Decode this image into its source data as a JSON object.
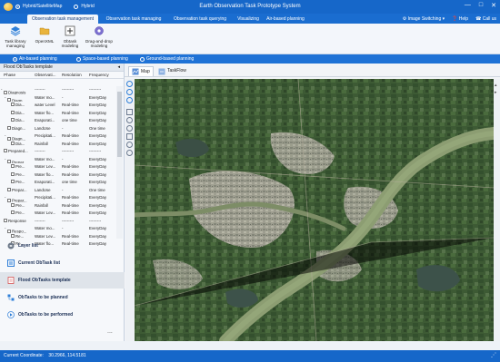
{
  "titlebar": {
    "map_options": [
      "Hybrid/SatelliteMap",
      "Hybrid"
    ],
    "title": "Earth Observation Task Prototype System",
    "win_buttons": [
      "—",
      "□",
      "✕"
    ]
  },
  "menubar": {
    "tabs": [
      "Observation task management",
      "Observation task managing",
      "Observation task querying",
      "Visualizing",
      "Air-based planning"
    ],
    "right": [
      "Image Switching",
      "Help",
      "Call us"
    ]
  },
  "ribbon": {
    "buttons": [
      "Task library managing",
      "OpenXML",
      "Obtask modeling",
      "Drag-and-drop modeling"
    ]
  },
  "planbar": {
    "options": [
      "Air-based planning",
      "Space-based planning",
      "Ground-based planning"
    ],
    "selected": 0
  },
  "leftpanel": {
    "title": "Flood ObTasks template",
    "columns": [
      "Phase",
      "Observati...",
      "Resolution",
      "Frequency"
    ],
    "rows": [
      {
        "indent": 0,
        "exp": "-",
        "phase": "Diagnosis",
        "obs": "--------",
        "res": "---------",
        "freq": "---------"
      },
      {
        "indent": 1,
        "exp": "-",
        "phase": "Diagn...",
        "obs": "Water mo...",
        "res": "-",
        "freq": "EveryDay"
      },
      {
        "indent": 2,
        "exp": "",
        "phase": "Dia...",
        "obs": "water Level",
        "res": "Real-time",
        "freq": "EveryDay"
      },
      {
        "indent": 2,
        "exp": "",
        "phase": "Dia...",
        "obs": "Water flo...",
        "res": "Real-time",
        "freq": "EveryDay"
      },
      {
        "indent": 2,
        "exp": "",
        "phase": "Dia...",
        "obs": "Evaporati...",
        "res": "one time",
        "freq": "EveryDay"
      },
      {
        "indent": 1,
        "exp": "",
        "phase": "Diagn...",
        "obs": "LandUse",
        "res": "-",
        "freq": "One time"
      },
      {
        "indent": 1,
        "exp": "-",
        "phase": "Diagn...",
        "obs": "Precipitati...",
        "res": "Real-time",
        "freq": "EveryDay"
      },
      {
        "indent": 2,
        "exp": "",
        "phase": "Dia...",
        "obs": "Rainfall",
        "res": "Real-time",
        "freq": "EveryDay"
      },
      {
        "indent": 0,
        "exp": "",
        "phase": "Prepared...",
        "obs": "--------",
        "res": "---------",
        "freq": "---------"
      },
      {
        "indent": 1,
        "exp": "-",
        "phase": "Prepar...",
        "obs": "Water mo...",
        "res": "-",
        "freq": "EveryDay"
      },
      {
        "indent": 2,
        "exp": "",
        "phase": "Pre...",
        "obs": "Water Lev...",
        "res": "Real-time",
        "freq": "EveryDay"
      },
      {
        "indent": 2,
        "exp": "",
        "phase": "Pre...",
        "obs": "Water flo...",
        "res": "Real-time",
        "freq": "EveryDay"
      },
      {
        "indent": 2,
        "exp": "",
        "phase": "Pre...",
        "obs": "Evaporati...",
        "res": "one time",
        "freq": "EveryDay"
      },
      {
        "indent": 1,
        "exp": "",
        "phase": "Prepar...",
        "obs": "LandUse",
        "res": "-",
        "freq": "One time"
      },
      {
        "indent": 1,
        "exp": "-",
        "phase": "Prepar...",
        "obs": "Precipitati...",
        "res": "Real-time",
        "freq": "EveryDay"
      },
      {
        "indent": 2,
        "exp": "",
        "phase": "Pre...",
        "obs": "Rainfall",
        "res": "Real-time",
        "freq": "EveryDay"
      },
      {
        "indent": 2,
        "exp": "",
        "phase": "Pre...",
        "obs": "Water Lev...",
        "res": "Real-time",
        "freq": "EveryDay"
      },
      {
        "indent": 0,
        "exp": "",
        "phase": "Response",
        "obs": "--------",
        "res": "---------",
        "freq": "---------"
      },
      {
        "indent": 1,
        "exp": "-",
        "phase": "Respo...",
        "obs": "Water mo...",
        "res": "-",
        "freq": "EveryDay"
      },
      {
        "indent": 2,
        "exp": "",
        "phase": "Re...",
        "obs": "Water Lev...",
        "res": "Real-time",
        "freq": "EveryDay"
      },
      {
        "indent": 2,
        "exp": "",
        "phase": "Re...",
        "obs": "Water flo...",
        "res": "Real-time",
        "freq": "EveryDay"
      }
    ],
    "nav": [
      "Layer list",
      "Current ObTask list",
      "Flood ObTasks template",
      "ObTasks to be planned",
      "ObTasks to be performed"
    ],
    "nav_selected": 2,
    "more": "..."
  },
  "maptabs": [
    "Map",
    "TaskFlow"
  ],
  "status": {
    "label": "Current Coordinate:",
    "coords": "30.2966,  114.5181"
  },
  "colors": {
    "titlebar": "#1667c9",
    "river": "#8c9d72",
    "urban": "#a9a69a",
    "vegetation": "#3d5a34"
  },
  "icons": [
    "layers-icon",
    "folder-icon",
    "obtask-modeling-icon",
    "drag-drop-icon",
    "map-icon",
    "taskflow-icon",
    "settings-icon",
    "help-icon",
    "phone-icon"
  ]
}
